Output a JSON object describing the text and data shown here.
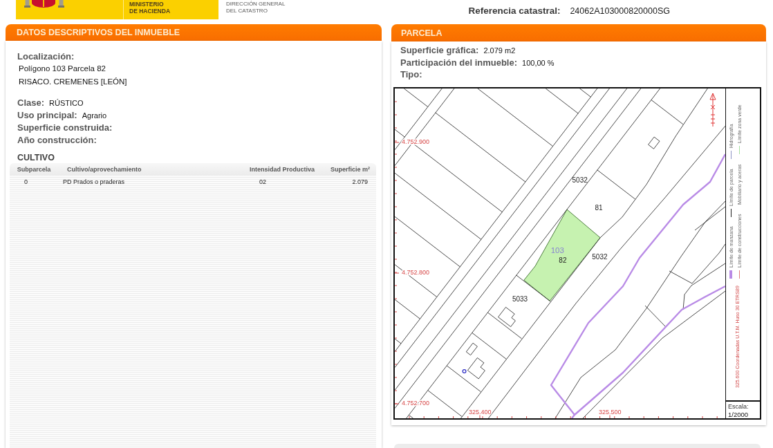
{
  "header": {
    "ministry": [
      "MINISTERIO",
      "DE HACIENDA"
    ],
    "directorate": [
      "DIRECCIÓN GENERAL",
      "DEL CATASTRO"
    ],
    "reference": {
      "label": "Referencia catastral:",
      "value": "24062A103000820000SG"
    }
  },
  "property_panel": {
    "title": "DATOS DESCRIPTIVOS DEL INMUEBLE",
    "location": {
      "label": "Localización:",
      "lines": [
        "Polígono 103 Parcela 82",
        "RISACO. CREMENES [LEÓN]"
      ]
    },
    "fields": [
      {
        "label": "Clase:",
        "value": "RÚSTICO"
      },
      {
        "label": "Uso principal:",
        "value": "Agrario"
      },
      {
        "label": "Superficie construida:"
      },
      {
        "label": "Año construcción:"
      }
    ],
    "crops": {
      "title": "CULTIVO",
      "columns": [
        "Subparcela",
        "Cultivo/aprovechamiento",
        "Intensidad Productiva",
        "Superficie m²"
      ],
      "rows": [
        [
          "0",
          "PD Prados o praderas",
          "02",
          "2.079"
        ]
      ]
    }
  },
  "parcel_panel": {
    "title": "PARCELA",
    "fields": [
      {
        "label": "Superficie gráfica:",
        "value": "2.079 m2"
      },
      {
        "label": "Participación del inmueble:",
        "value": "100,00 %"
      },
      {
        "label": "Tipo:"
      }
    ],
    "map": {
      "northings": [
        "4.752.900",
        "4.752.800",
        "4.752.700"
      ],
      "eastings": [
        "325.400",
        "325.500"
      ],
      "parcel_labels": [
        {
          "text": "5032",
          "kind": "parcel"
        },
        {
          "text": "81",
          "kind": "parcel"
        },
        {
          "text": "103",
          "kind": "polygon"
        },
        {
          "text": "82",
          "kind": "parcel"
        },
        {
          "text": "5032",
          "kind": "parcel"
        },
        {
          "text": "5033",
          "kind": "parcel"
        }
      ],
      "coordinates_note": "325.600 Coordenadas U.T.M. Huso 30 ETRS89",
      "legend_columns": [
        {
          "items": [
            {
              "label": "Límite de manzana",
              "kind": "band",
              "color": "#b98be6"
            },
            {
              "label": "Límite de parcela",
              "kind": "line",
              "color": "#222222"
            },
            {
              "label": "Hidrografía",
              "kind": "line",
              "color": "#8e93c4"
            }
          ]
        },
        {
          "items": [
            {
              "label": "Límite de construcciones",
              "kind": "line",
              "color": "#e07c7c"
            },
            {
              "label": "Mobiliario y aceras",
              "kind": "plain"
            },
            {
              "label": "Límite zona verde",
              "kind": "line",
              "color": "#a6e0a0"
            }
          ]
        }
      ],
      "scale": {
        "label": "Escala:",
        "value": "1/2000"
      }
    }
  }
}
